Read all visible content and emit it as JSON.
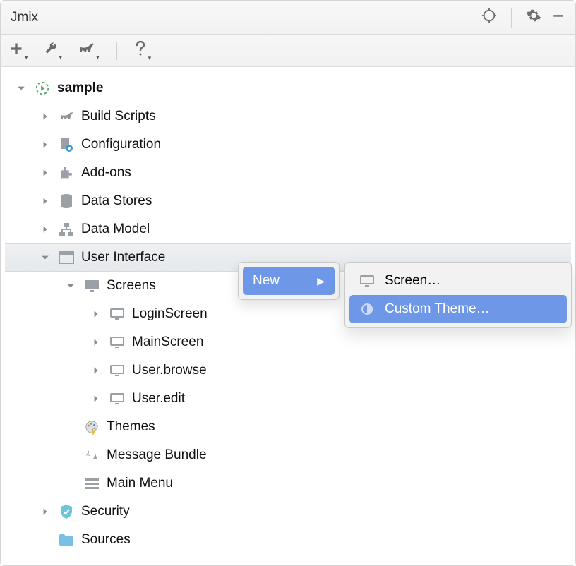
{
  "titlebar": {
    "title": "Jmix"
  },
  "toolbar": {},
  "tree": {
    "root": {
      "label": "sample"
    },
    "nodes": [
      {
        "label": "Build Scripts"
      },
      {
        "label": "Configuration"
      },
      {
        "label": "Add-ons"
      },
      {
        "label": "Data Stores"
      },
      {
        "label": "Data Model"
      },
      {
        "label": "User Interface"
      },
      {
        "label": "Security"
      },
      {
        "label": "Sources"
      }
    ],
    "ui": {
      "screens": {
        "label": "Screens"
      },
      "screens_items": [
        {
          "label": "LoginScreen"
        },
        {
          "label": "MainScreen"
        },
        {
          "label": "User.browse"
        },
        {
          "label": "User.edit"
        }
      ],
      "themes": {
        "label": "Themes"
      },
      "bundle": {
        "label": "Message Bundle"
      },
      "menu": {
        "label": "Main Menu"
      }
    }
  },
  "context": {
    "new": "New",
    "sub": [
      {
        "label": "Screen…"
      },
      {
        "label": "Custom Theme…"
      }
    ]
  }
}
